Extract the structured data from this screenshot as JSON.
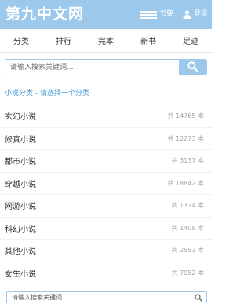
{
  "header": {
    "logo": "第九中文网",
    "shelf_label": "书架",
    "login_label": "登录",
    "bg_color": "#9cc9eb"
  },
  "nav": {
    "items": [
      {
        "label": "分类"
      },
      {
        "label": "排行"
      },
      {
        "label": "完本"
      },
      {
        "label": "新书"
      },
      {
        "label": "足迹"
      }
    ]
  },
  "search_top": {
    "placeholder": "请输入搜索关键词...",
    "icon": "search-icon"
  },
  "section": {
    "title": "小说分类 - 请选择一个分类"
  },
  "categories": [
    {
      "name": "玄幻小说",
      "count": "共 14765 本"
    },
    {
      "name": "修真小说",
      "count": "共 12273 本"
    },
    {
      "name": "都市小说",
      "count": "共 3137 本"
    },
    {
      "name": "穿越小说",
      "count": "共 18842 本"
    },
    {
      "name": "网游小说",
      "count": "共 1324 本"
    },
    {
      "name": "科幻小说",
      "count": "共 1408 本"
    },
    {
      "name": "其他小说",
      "count": "共 2553 本"
    },
    {
      "name": "女生小说",
      "count": "共 7052 本"
    }
  ],
  "search_bottom": {
    "placeholder": "请输入搜索关键词...",
    "icon": "search-icon"
  },
  "colors": {
    "accent": "#9cc9eb",
    "section_title": "#4a9ad6",
    "count_text": "#a5a5a5"
  }
}
